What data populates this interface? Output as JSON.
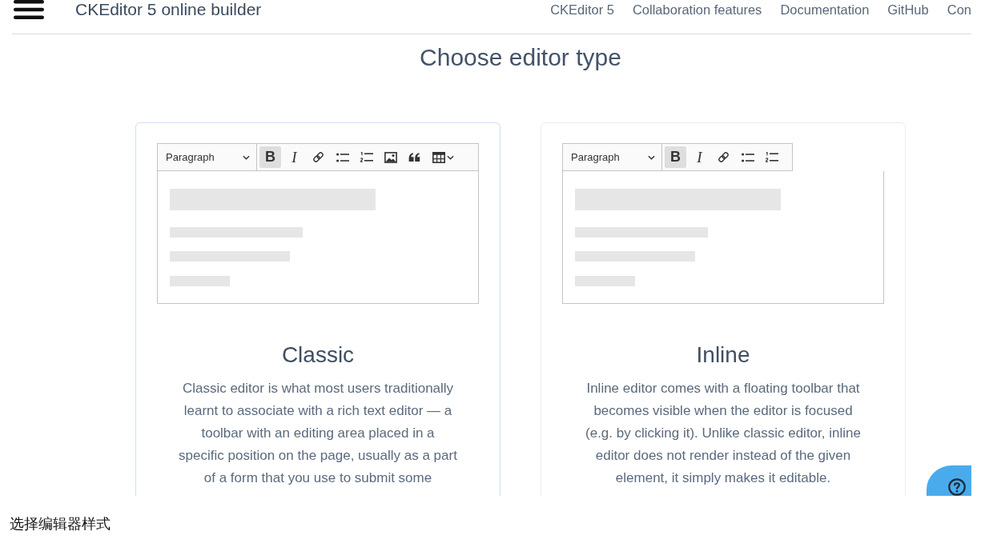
{
  "nav": {
    "title": "CKEditor 5 online builder",
    "links": [
      "CKEditor 5",
      "Collaboration features",
      "Documentation",
      "GitHub",
      "Con"
    ]
  },
  "heading": "Choose editor type",
  "editor_types": [
    {
      "kind": "classic",
      "selected": true,
      "toolbar": {
        "dropdown": "Paragraph",
        "buttons": [
          {
            "kind": "bold",
            "label": "B",
            "on": true
          },
          {
            "kind": "italic",
            "label": "I",
            "on": false
          },
          {
            "kind": "link",
            "on": false
          },
          {
            "kind": "bulleted-list",
            "on": false
          },
          {
            "kind": "numbered-list",
            "on": false
          },
          {
            "kind": "image",
            "on": false
          },
          {
            "kind": "quote",
            "on": false
          },
          {
            "kind": "table",
            "on": false
          }
        ]
      },
      "name": "Classic",
      "description_lines": [
        "Classic editor is what most users traditionally",
        "learnt to associate with a rich text editor — a",
        "toolbar with an editing area placed in a",
        "specific position on the page, usually as a part",
        "of a form that you use to submit some"
      ]
    },
    {
      "kind": "inline",
      "selected": false,
      "toolbar": {
        "dropdown": "Paragraph",
        "buttons": [
          {
            "kind": "bold",
            "label": "B",
            "on": true
          },
          {
            "kind": "italic",
            "label": "I",
            "on": false
          },
          {
            "kind": "link",
            "on": false
          },
          {
            "kind": "bulleted-list",
            "on": false
          },
          {
            "kind": "numbered-list",
            "on": false
          }
        ]
      },
      "name": "Inline",
      "description_lines": [
        "Inline editor comes with a floating toolbar that",
        "becomes visible when the editor is focused",
        "(e.g. by clicking it). Unlike classic editor, inline",
        "editor does not render instead of the given",
        "element, it simply makes it editable."
      ]
    }
  ],
  "caption": "选择编辑器样式"
}
